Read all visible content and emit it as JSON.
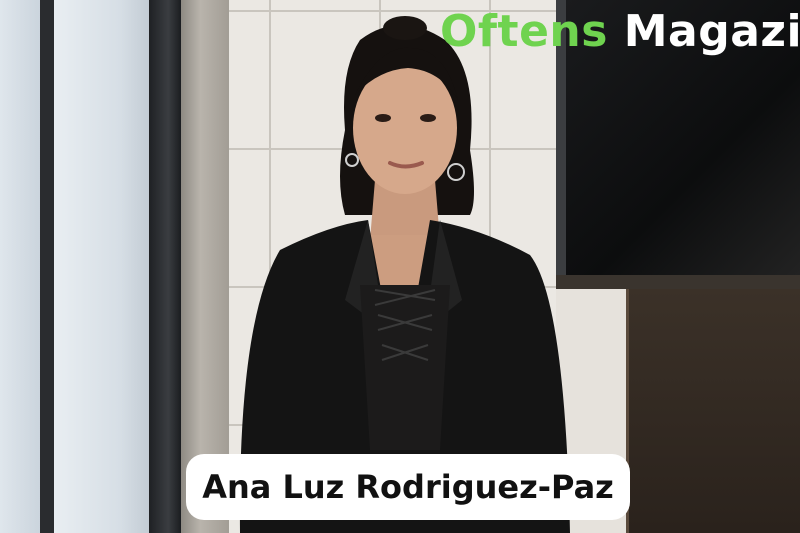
{
  "photo": {
    "subject": "portrait-photo"
  },
  "watermark": {
    "part1": "Oftens",
    "part2": "Magazi",
    "color_green": "#6fd34f",
    "color_white": "#ffffff"
  },
  "caption": {
    "name": "Ana Luz Rodriguez-Paz"
  }
}
